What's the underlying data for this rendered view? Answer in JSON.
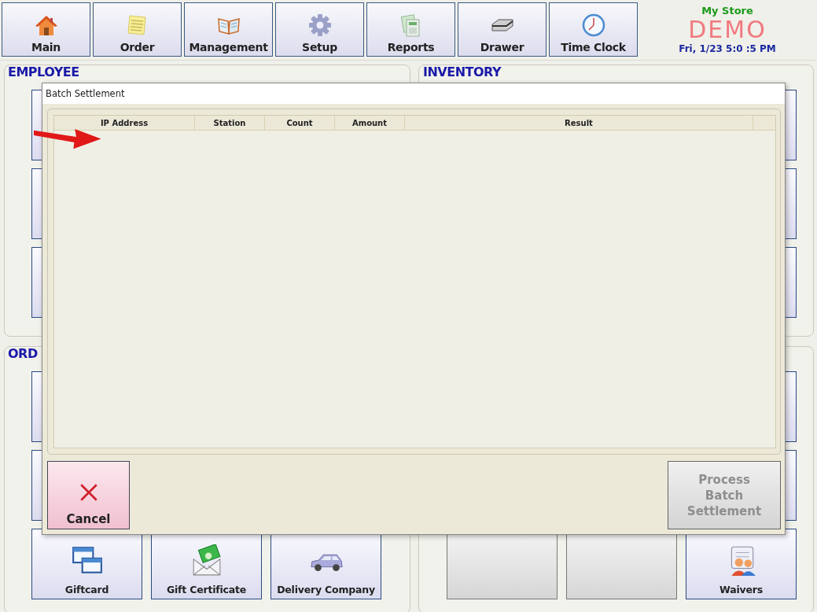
{
  "toolbar": [
    {
      "label": "Main"
    },
    {
      "label": "Order"
    },
    {
      "label": "Management"
    },
    {
      "label": "Setup"
    },
    {
      "label": "Reports"
    },
    {
      "label": "Drawer"
    },
    {
      "label": "Time Clock"
    }
  ],
  "store": {
    "name": "My Store",
    "datetime": "Fri, 1/23 5:0 :5 PM",
    "mode_label": "DEMO"
  },
  "panels": [
    {
      "title": "EMPLOYEE"
    },
    {
      "title": "INVENTORY"
    },
    {
      "title": "ORD",
      "tiles": [
        {
          "label": "Giftcard",
          "disabled": false
        },
        {
          "label": "Gift Certificate",
          "disabled": false
        },
        {
          "label": "Delivery Company",
          "disabled": false
        }
      ]
    },
    {
      "tiles": [
        {
          "disabled": true
        },
        {
          "disabled": true
        },
        {
          "label": "Waivers",
          "disabled": false
        }
      ]
    }
  ],
  "dialog": {
    "title": "Batch Settlement",
    "columns": [
      "IP Address",
      "Station",
      "Count",
      "Amount",
      "Result"
    ],
    "cancel": {
      "label": "Cancel"
    },
    "process": {
      "label": "Process Batch Settlement",
      "disabled": true
    }
  }
}
